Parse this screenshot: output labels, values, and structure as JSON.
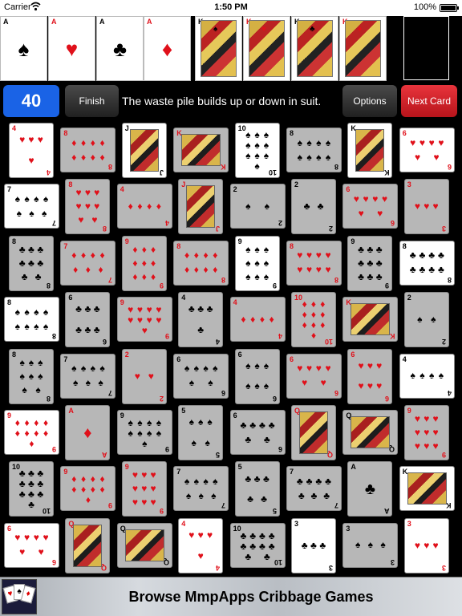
{
  "status_bar": {
    "carrier": "Carrier",
    "time": "1:50 PM",
    "battery": "100%"
  },
  "foundation": [
    {
      "rank": "A",
      "suit": "♠",
      "color": "black"
    },
    {
      "rank": "A",
      "suit": "♥",
      "color": "red"
    },
    {
      "rank": "A",
      "suit": "♣",
      "color": "black"
    },
    {
      "rank": "A",
      "suit": "♦",
      "color": "red"
    },
    {
      "rank": "K",
      "suit": "♠",
      "color": "black"
    },
    {
      "rank": "K",
      "suit": "♥",
      "color": "red"
    },
    {
      "rank": "K",
      "suit": "♣",
      "color": "black"
    },
    {
      "rank": "K",
      "suit": "♦",
      "color": "red"
    }
  ],
  "controls": {
    "score": "40",
    "finish_label": "Finish",
    "message": "The waste pile builds up or down in suit.",
    "options_label": "Options",
    "next_card_label": "Next Card"
  },
  "grid": [
    [
      "4♥w",
      "8♦g",
      "J♣w",
      "K♦g",
      "10♠w",
      "8♠g",
      "K♣w",
      "6♥w"
    ],
    [
      "7♠w",
      "8♥g",
      "4♦g",
      "J♦g",
      "2♠g",
      "2♣g",
      "6♥g",
      "3♥g"
    ],
    [
      "8♣g",
      "7♦g",
      "9♦g",
      "8♦g",
      "9♠w",
      "8♥g",
      "9♣g",
      "8♣w"
    ],
    [
      "8♠w",
      "6♣g",
      "9♥g",
      "4♣g",
      "4♦g",
      "10♦g",
      "K♥g",
      "2♠g"
    ],
    [
      "8♠g",
      "7♠g",
      "2♥g",
      "6♠g",
      "6♠g",
      "6♥g",
      "6♥g",
      "4♠w"
    ],
    [
      "9♦w",
      "A♦g",
      "9♠g",
      "5♠g",
      "6♣g",
      "Q♦g",
      "Q♣g",
      "9♥g"
    ],
    [
      "10♣g",
      "9♦g",
      "9♥g",
      "7♠g",
      "5♣g",
      "7♣g",
      "A♣g",
      "K♠w"
    ],
    [
      "6♥w",
      "Q♥g",
      "Q♠g",
      "4♥w",
      "10♣g",
      "3♣w",
      "3♠g",
      "3♥w"
    ]
  ],
  "banner": {
    "text": "Browse MmpApps Cribbage Games",
    "icon": "cribbage-cards-icon"
  },
  "colors": {
    "score_blue": "#1a63e6",
    "next_red": "#d3232b",
    "card_gray": "#b7b7b7"
  }
}
